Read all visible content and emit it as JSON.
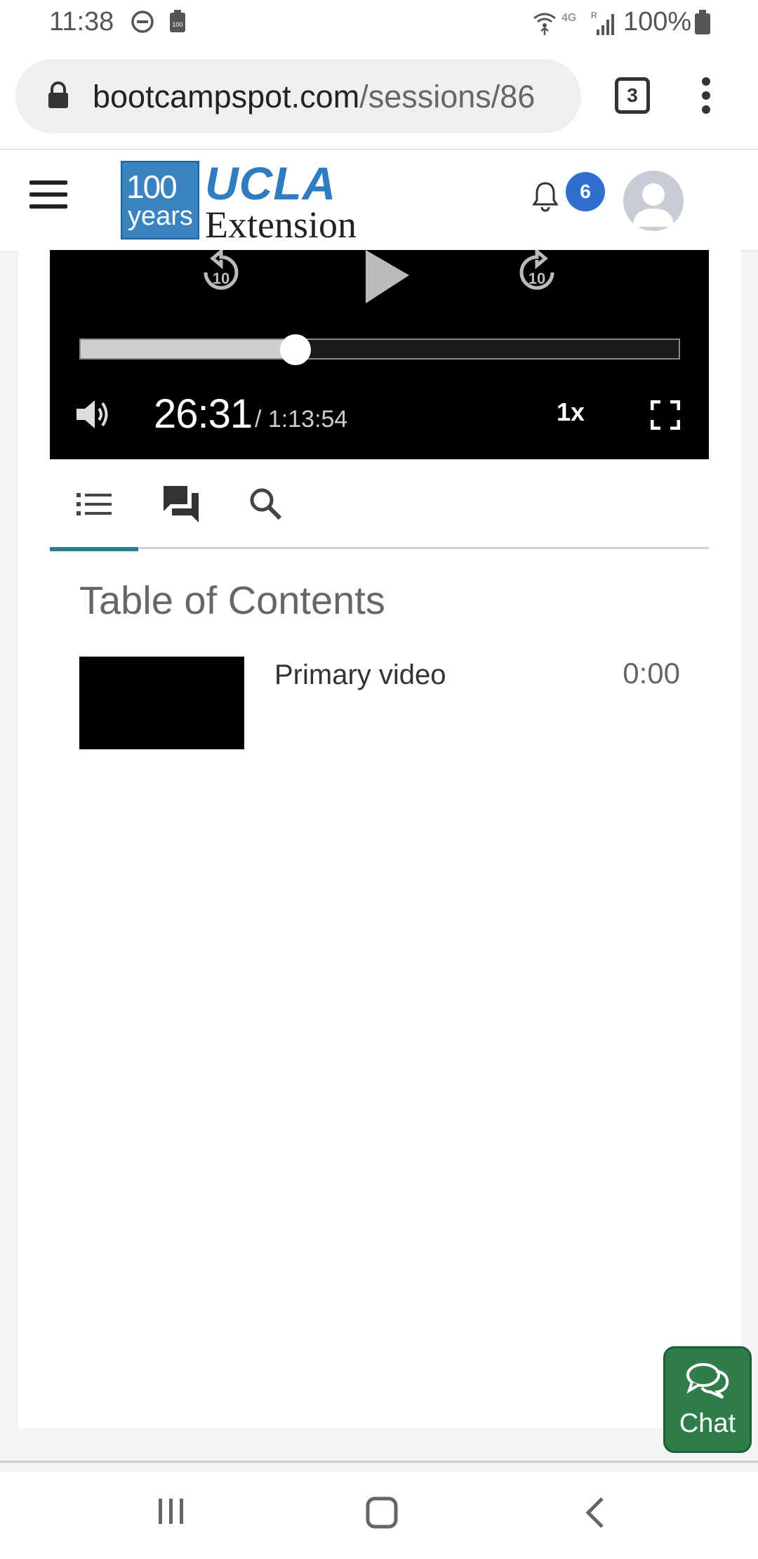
{
  "status_bar": {
    "time": "11:38",
    "battery_percent": "100%",
    "network": "4G"
  },
  "browser": {
    "url_host": "bootcampspot.com",
    "url_path": "/sessions/86",
    "tab_count": "3"
  },
  "site_header": {
    "logo_years_number": "100",
    "logo_years_word": "years",
    "logo_ucla": "UCLA",
    "logo_extension": "Extension",
    "notification_count": "6"
  },
  "player": {
    "current_time": "26:31",
    "total_time": "/ 1:13:54",
    "playback_speed": "1x",
    "skip_back_seconds": "10",
    "skip_forward_seconds": "10",
    "progress_fraction": 0.359
  },
  "tabs": [
    {
      "name": "table-of-contents",
      "icon": "list-icon",
      "active": true
    },
    {
      "name": "chat",
      "icon": "chat-bubbles-icon",
      "active": false
    },
    {
      "name": "search",
      "icon": "search-icon",
      "active": false
    }
  ],
  "toc": {
    "title": "Table of Contents",
    "items": [
      {
        "label": "Primary video",
        "time": "0:00"
      }
    ]
  },
  "chat_button": {
    "label": "Chat"
  },
  "colors": {
    "accent_teal": "#2a7c8e",
    "ucla_blue": "#2f7cc0",
    "chat_green": "#2e7d4a",
    "badge_blue": "#2f6fcf"
  }
}
